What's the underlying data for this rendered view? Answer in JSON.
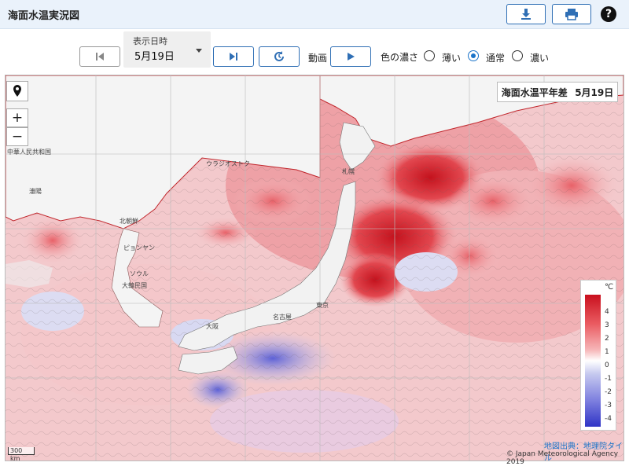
{
  "header": {
    "title": "海面水温実況図"
  },
  "controls": {
    "date_label": "表示日時",
    "date_value": "5月19日",
    "animation_label": "動画",
    "density_label": "色の濃さ",
    "density_options": [
      "薄い",
      "通常",
      "濃い"
    ],
    "density_selected": "通常"
  },
  "map": {
    "title": "海面水温平年差",
    "date": "5月19日",
    "legend": {
      "unit": "℃",
      "ticks": [
        "4",
        "3",
        "2",
        "1",
        "0",
        "-1",
        "-2",
        "-3",
        "-4"
      ]
    },
    "scale": "300 km",
    "credit_map": "地図出典：地理院タイル",
    "credit_jma": "© Japan Meteorological Agency 2019",
    "place_labels": [
      "札幌",
      "ウラジオストク",
      "北朝鮮",
      "ピョンヤン",
      "ソウル",
      "大韓民国",
      "瀋陽",
      "中華人民共和国",
      "東京",
      "名古屋",
      "大阪"
    ],
    "zoom_in": "+",
    "zoom_out": "−",
    "colors": {
      "warm": "#d7202d",
      "neutral": "#ffffff",
      "cold": "#2f34c6"
    }
  }
}
